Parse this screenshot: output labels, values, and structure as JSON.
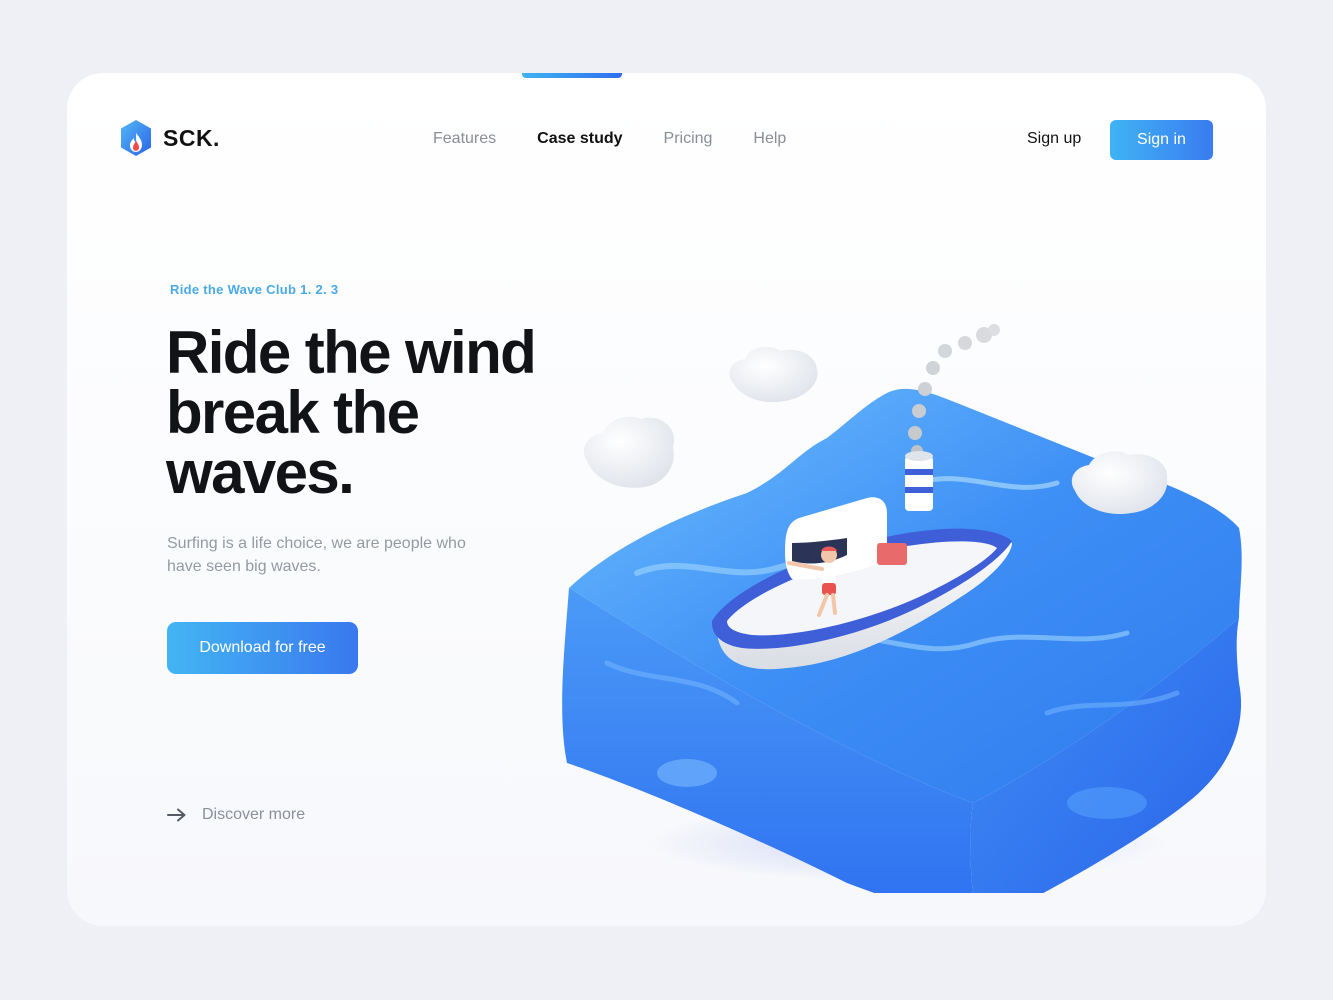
{
  "brand": {
    "name": "SCK.",
    "logo_icon": "flame-hexagon-icon"
  },
  "nav": {
    "items": [
      {
        "label": "Features",
        "active": false
      },
      {
        "label": "Case study",
        "active": true
      },
      {
        "label": "Pricing",
        "active": false
      },
      {
        "label": "Help",
        "active": false
      }
    ]
  },
  "auth": {
    "signup_label": "Sign up",
    "signin_label": "Sign in"
  },
  "hero": {
    "eyebrow": "Ride the Wave Club 1. 2. 3",
    "headline": [
      "Ride the wind",
      "break the",
      "waves."
    ],
    "description": "Surfing is a life choice, we are people who have seen big waves.",
    "cta_label": "Download for free",
    "discover_label": "Discover more",
    "discover_icon": "arrow-right-icon"
  },
  "colors": {
    "accent": "#3a7cf0",
    "accent_light": "#3fb3f4",
    "eyebrow": "#4aa9e9",
    "water": "#3d8ef5",
    "background": "#eef0f5"
  }
}
